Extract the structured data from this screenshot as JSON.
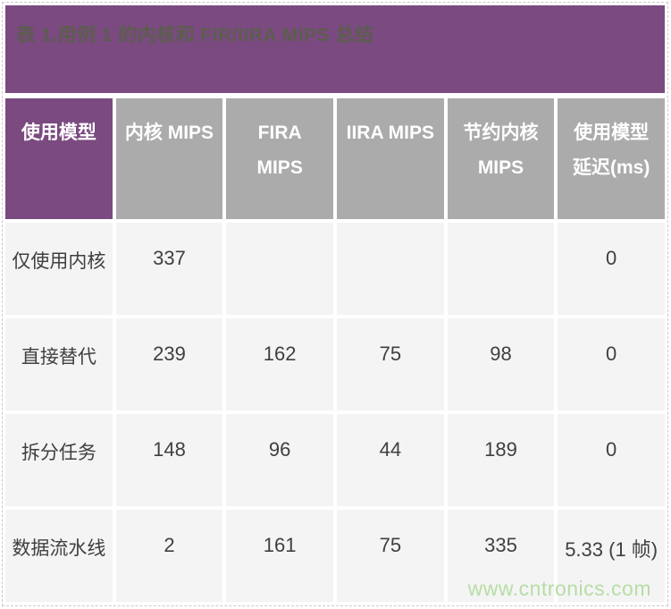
{
  "caption": "表 1.用例 1 的内核和 FIR/IIRA MIPS 总结",
  "colors": {
    "banner_purple": "#7a4a80",
    "header_gray": "#ababab",
    "row_bg": "#f5f4f5",
    "caption_text": "#5d5d4f",
    "watermark_green": "#b7dda6"
  },
  "table": {
    "columns": [
      {
        "label": "使用模型"
      },
      {
        "label": "内核 MIPS"
      },
      {
        "label": "FIRA MIPS"
      },
      {
        "label": "IIRA MIPS"
      },
      {
        "label": "节约内核 MIPS"
      },
      {
        "label": "使用模型延迟(ms)"
      }
    ],
    "rows": [
      {
        "label": "仅使用内核",
        "cells": [
          "337",
          "",
          "",
          "",
          "0"
        ]
      },
      {
        "label": "直接替代",
        "cells": [
          "239",
          "162",
          "75",
          "98",
          "0"
        ]
      },
      {
        "label": "拆分任务",
        "cells": [
          "148",
          "96",
          "44",
          "189",
          "0"
        ]
      },
      {
        "label": "数据流水线",
        "cells": [
          "2",
          "161",
          "75",
          "335",
          "5.33 (1 帧)"
        ]
      }
    ]
  },
  "watermark": "www.cntronics.com"
}
